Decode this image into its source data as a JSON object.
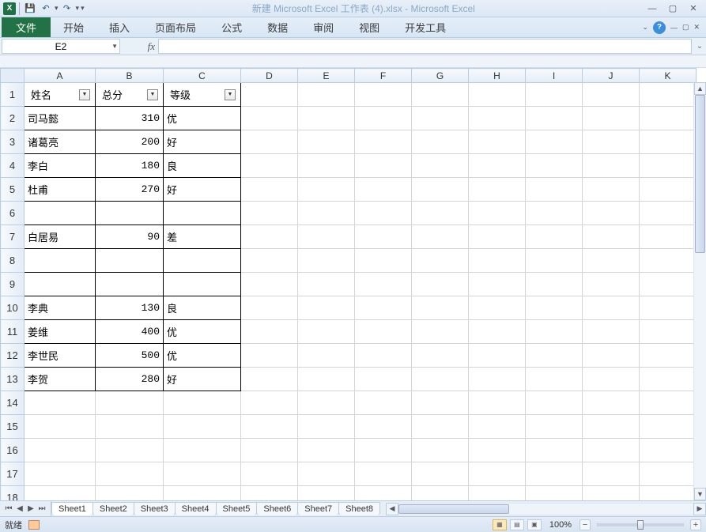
{
  "title": "新建 Microsoft Excel 工作表 (4).xlsx - Microsoft Excel",
  "ribbon": {
    "file": "文件",
    "tabs": [
      "开始",
      "插入",
      "页面布局",
      "公式",
      "数据",
      "审阅",
      "视图",
      "开发工具"
    ]
  },
  "name_box": "E2",
  "fx_label": "fx",
  "columns": [
    "A",
    "B",
    "C",
    "D",
    "E",
    "F",
    "G",
    "H",
    "I",
    "J",
    "K"
  ],
  "header_row": {
    "a": "姓名",
    "b": "总分",
    "c": "等级"
  },
  "rows": [
    {
      "n": 1,
      "a": "姓名",
      "b": "总分",
      "c": "等级",
      "hdr": true
    },
    {
      "n": 2,
      "a": "司马懿",
      "b": "310",
      "c": "优"
    },
    {
      "n": 3,
      "a": "诸葛亮",
      "b": "200",
      "c": "好"
    },
    {
      "n": 4,
      "a": "李白",
      "b": "180",
      "c": "良"
    },
    {
      "n": 5,
      "a": "杜甫",
      "b": "270",
      "c": "好"
    },
    {
      "n": 6,
      "a": "",
      "b": "",
      "c": ""
    },
    {
      "n": 7,
      "a": "白居易",
      "b": "90",
      "c": "差"
    },
    {
      "n": 8,
      "a": "",
      "b": "",
      "c": ""
    },
    {
      "n": 9,
      "a": "",
      "b": "",
      "c": ""
    },
    {
      "n": 10,
      "a": "李典",
      "b": "130",
      "c": "良"
    },
    {
      "n": 11,
      "a": "姜维",
      "b": "400",
      "c": "优"
    },
    {
      "n": 12,
      "a": "李世民",
      "b": "500",
      "c": "优"
    },
    {
      "n": 13,
      "a": "李贺",
      "b": "280",
      "c": "好"
    },
    {
      "n": 14,
      "a": "",
      "b": "",
      "c": "",
      "noborder": true
    },
    {
      "n": 15,
      "a": "",
      "b": "",
      "c": "",
      "noborder": true
    },
    {
      "n": 16,
      "a": "",
      "b": "",
      "c": "",
      "noborder": true
    },
    {
      "n": 17,
      "a": "",
      "b": "",
      "c": "",
      "noborder": true
    },
    {
      "n": 18,
      "a": "",
      "b": "",
      "c": "",
      "noborder": true
    }
  ],
  "sheets": [
    "Sheet1",
    "Sheet2",
    "Sheet3",
    "Sheet4",
    "Sheet5",
    "Sheet6",
    "Sheet7",
    "Sheet8"
  ],
  "status": {
    "ready": "就绪",
    "zoom": "100%"
  }
}
